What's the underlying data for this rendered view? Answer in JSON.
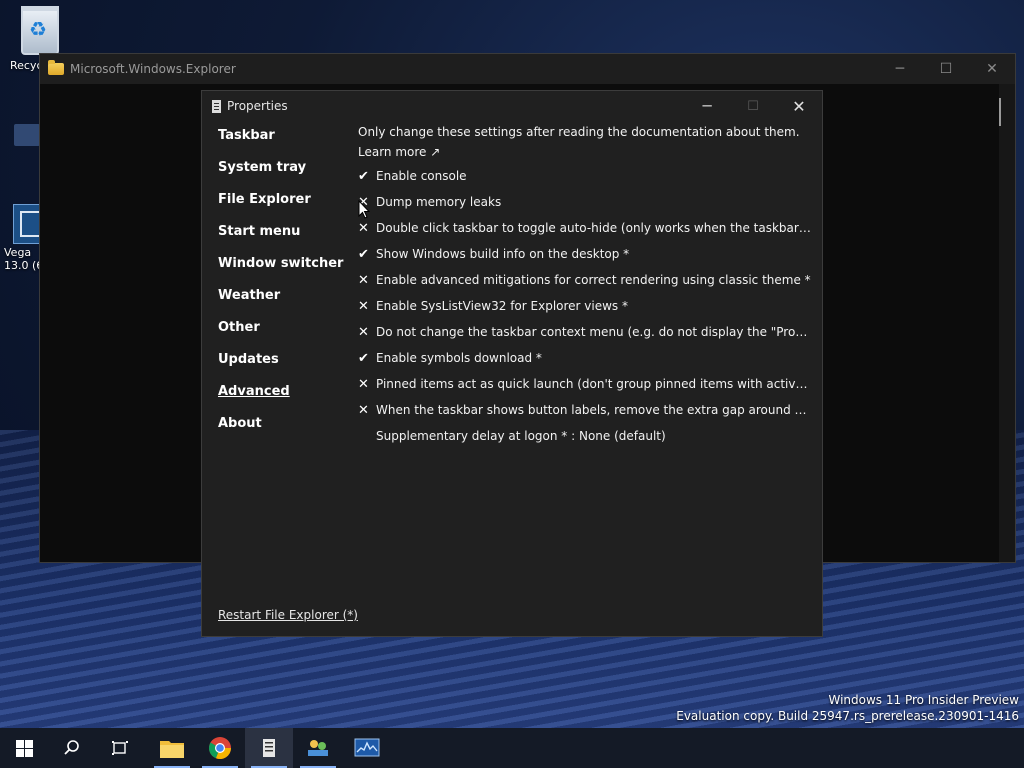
{
  "desktop": {
    "recycle_label": "Recyc",
    "vegas_label_1": "Vega",
    "vegas_label_2": "13.0 (6"
  },
  "explorer_window": {
    "title": "Microsoft.Windows.Explorer"
  },
  "properties": {
    "title": "Properties",
    "nav": [
      {
        "label": "Taskbar"
      },
      {
        "label": "System tray"
      },
      {
        "label": "File Explorer"
      },
      {
        "label": "Start menu"
      },
      {
        "label": "Window switcher"
      },
      {
        "label": "Weather"
      },
      {
        "label": "Other"
      },
      {
        "label": "Updates"
      },
      {
        "label": "Advanced"
      },
      {
        "label": "About"
      }
    ],
    "active_nav": "Advanced",
    "intro": "Only change these settings after reading the documentation about them.",
    "learn_more": "Learn more ↗",
    "options": [
      {
        "mark": "✔",
        "label": "Enable console"
      },
      {
        "mark": "✕",
        "label": "Dump memory leaks"
      },
      {
        "mark": "✕",
        "label": "Double click taskbar to toggle auto-hide (only works when the taskbar is locked)"
      },
      {
        "mark": "✔",
        "label": "Show Windows build info on the desktop *"
      },
      {
        "mark": "✕",
        "label": "Enable advanced mitigations for correct rendering using classic theme *"
      },
      {
        "mark": "✕",
        "label": "Enable SysListView32 for Explorer views *"
      },
      {
        "mark": "✕",
        "label": "Do not change the taskbar context menu (e.g. do not display the \"Properties\" ite..."
      },
      {
        "mark": "✔",
        "label": "Enable symbols download *"
      },
      {
        "mark": "✕",
        "label": "Pinned items act as quick launch (don't group pinned items with active apps) *"
      },
      {
        "mark": "✕",
        "label": "When the taskbar shows button labels, remove the extra gap around pinned ite..."
      },
      {
        "mark": "",
        "label": "Supplementary delay at logon * : None (default)"
      }
    ],
    "restart": "Restart File Explorer (*)"
  },
  "watermark": {
    "line1": "Windows 11 Pro Insider Preview",
    "line2": "Evaluation copy. Build 25947.rs_prerelease.230901-1416"
  },
  "taskbar": {
    "items": [
      "start",
      "search",
      "task-view",
      "file-explorer",
      "chrome",
      "properties-app",
      "network-app",
      "monitor-app"
    ],
    "active_item": "properties-app"
  }
}
